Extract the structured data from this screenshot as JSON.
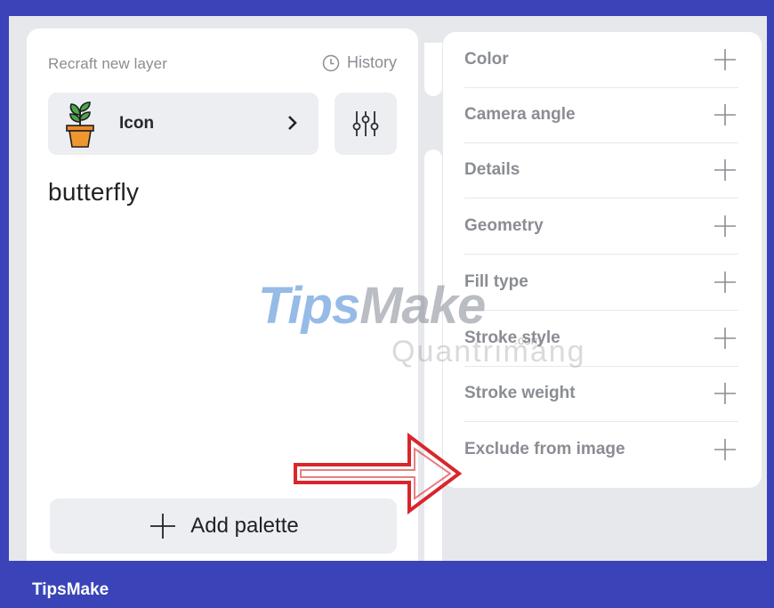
{
  "left_panel": {
    "header_title": "Recraft new layer",
    "history_label": "History",
    "style": {
      "label": "Icon"
    },
    "prompt": "butterfly",
    "add_palette_label": "Add palette"
  },
  "right_panel": {
    "options": [
      {
        "label": "Color"
      },
      {
        "label": "Camera angle"
      },
      {
        "label": "Details"
      },
      {
        "label": "Geometry"
      },
      {
        "label": "Fill type"
      },
      {
        "label": "Stroke style"
      },
      {
        "label": "Stroke weight"
      },
      {
        "label": "Exclude from image"
      }
    ]
  },
  "watermark": {
    "tips": "Tips",
    "make": "Make",
    "com": ".com",
    "sub": "Quantrimang"
  },
  "footer": {
    "brand": "TipsMake"
  },
  "colors": {
    "border": "#3a44b8",
    "arrow": "#d8262c",
    "panel_bg": "#e6e8ec"
  },
  "icons": [
    "clock-icon",
    "plant-pot-icon",
    "chevron-right-icon",
    "sliders-icon",
    "plus-icon"
  ]
}
